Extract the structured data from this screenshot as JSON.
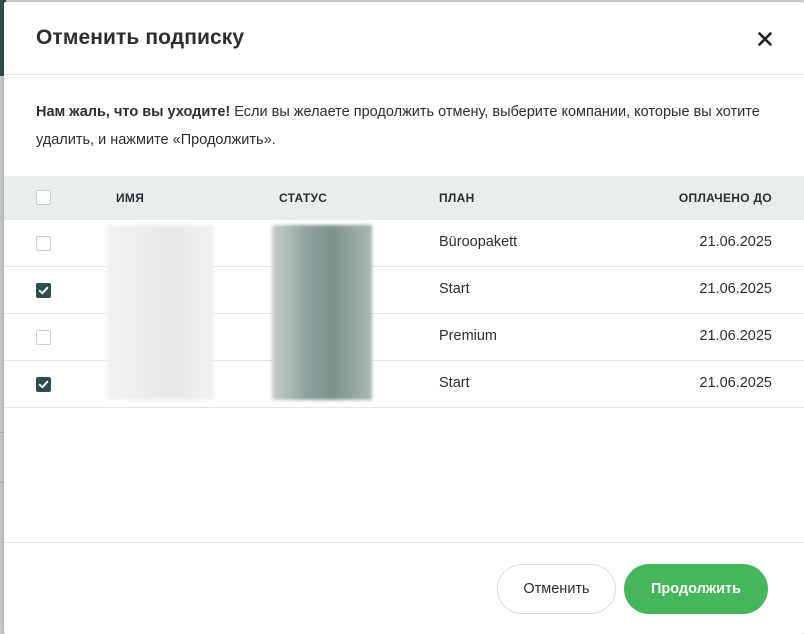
{
  "dialog": {
    "title": "Отменить подписку",
    "intro_bold": "Нам жаль, что вы уходите!",
    "intro_text": " Если вы желаете продолжить отмену, выберите компании, которые вы хотите удалить, и нажмите «Продолжить»."
  },
  "table": {
    "columns": {
      "name": "ИМЯ",
      "status": "СТАТУС",
      "plan": "ПЛАН",
      "paid_until": "ОПЛАЧЕНО ДО"
    },
    "rows": [
      {
        "checked": false,
        "plan": "Büroopakett",
        "paid_until": "21.06.2025"
      },
      {
        "checked": true,
        "plan": "Start",
        "paid_until": "21.06.2025"
      },
      {
        "checked": false,
        "plan": "Premium",
        "paid_until": "21.06.2025"
      },
      {
        "checked": true,
        "plan": "Start",
        "paid_until": "21.06.2025"
      }
    ]
  },
  "footer": {
    "cancel_label": "Отменить",
    "continue_label": "Продолжить"
  },
  "colors": {
    "accent": "#2f4f4f",
    "primary_button": "#45b75a",
    "header_background": "#e9edee"
  },
  "icons": {
    "close": "close-icon",
    "check": "check-icon"
  }
}
